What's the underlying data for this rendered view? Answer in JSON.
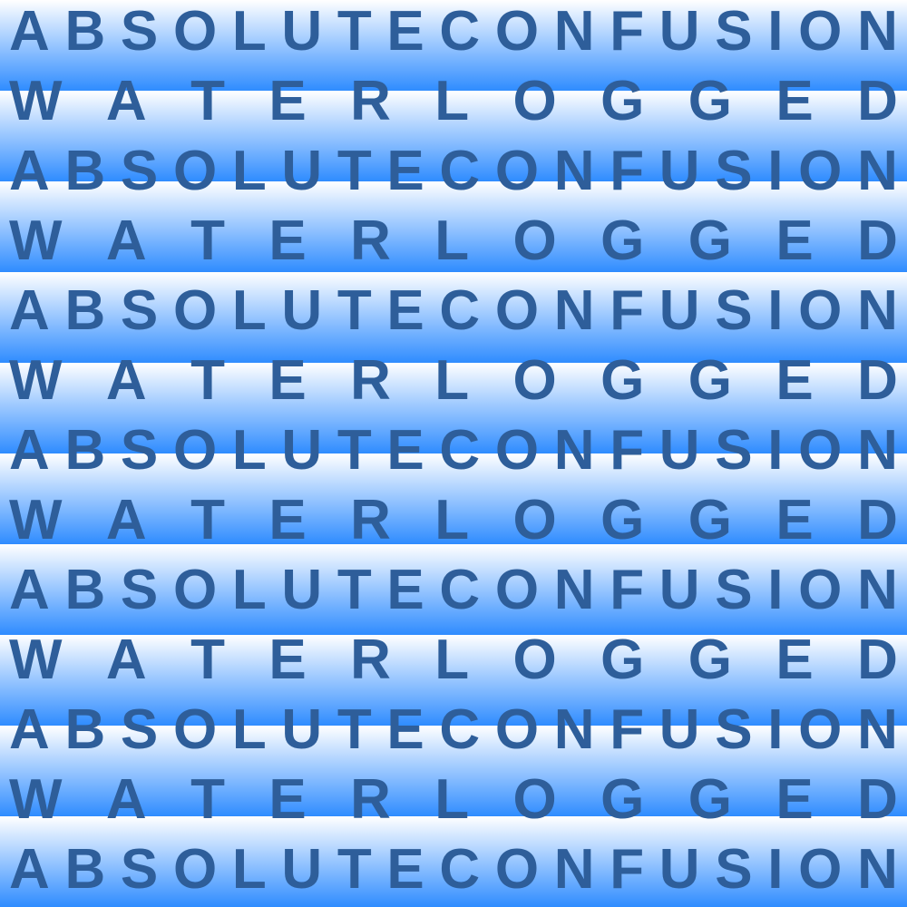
{
  "words": {
    "primary": "ABSOLUTECONFUSION",
    "secondary": "WATERLOGGED"
  },
  "rows": [
    "primary",
    "secondary",
    "primary",
    "secondary",
    "primary",
    "secondary",
    "primary",
    "secondary",
    "primary",
    "secondary",
    "primary",
    "secondary",
    "primary"
  ],
  "colors": {
    "text": "#2e5e9a",
    "band_top": "#ffffff",
    "band_bottom": "#2f8cff"
  }
}
